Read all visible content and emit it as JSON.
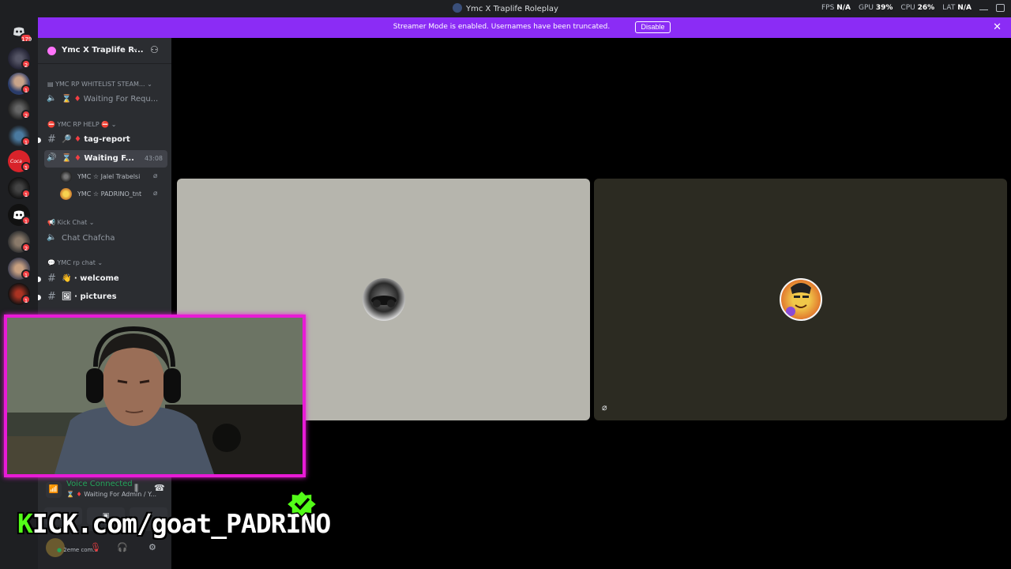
{
  "window": {
    "title": "Ymc X Traplife Roleplay"
  },
  "stats": {
    "fps_label": "FPS",
    "fps_value": "N/A",
    "gpu_label": "GPU",
    "gpu_value": "39%",
    "cpu_label": "CPU",
    "cpu_value": "26%",
    "lat_label": "LAT",
    "lat_value": "N/A"
  },
  "server_rail": {
    "servers": [
      {
        "name": "discord-home",
        "badge": ""
      },
      {
        "name": "server-1",
        "badge": "2"
      },
      {
        "name": "server-2",
        "badge": "1"
      },
      {
        "name": "server-3",
        "badge": "2"
      },
      {
        "name": "server-4",
        "badge": "1"
      },
      {
        "name": "server-5",
        "badge": "1"
      },
      {
        "name": "server-6",
        "badge": "1"
      },
      {
        "name": "server-7",
        "badge": "1"
      },
      {
        "name": "server-8",
        "badge": "2"
      },
      {
        "name": "server-9",
        "badge": "1"
      },
      {
        "name": "server-10",
        "badge": "1"
      }
    ]
  },
  "banner": {
    "message": "Streamer Mode is enabled. Usernames have been truncated.",
    "disable_label": "Disable"
  },
  "server_header": {
    "name": "Ymc X Traplife R..."
  },
  "channels": {
    "cat1": "YMC RP WHITELIST STEAM...",
    "ch_waiting1": "Waiting For Requ...",
    "cat2": "YMC RP HELP",
    "ch_tag_report": "tag-report",
    "ch_waiting2": "Waiting F...",
    "ch_waiting2_timer": "43:08",
    "voice_users": [
      {
        "name": "YMC ☆ Jalel Trabelsi"
      },
      {
        "name": "YMC ☆ PADRINO_tnt"
      }
    ],
    "cat3": "Kick Chat",
    "ch_chat": "Chat Chafcha",
    "cat4": "YMC rp chat",
    "ch_welcome": "welcome",
    "ch_pictures": "pictures"
  },
  "voice_panel": {
    "status": "Voice Connected",
    "where": "Waiting For Admin / Y..."
  },
  "user_panel": {
    "name": "2eme com..."
  },
  "overlay": {
    "kick_prefix": "K",
    "kick_text": "ICK.com/goat_PADRINO"
  }
}
